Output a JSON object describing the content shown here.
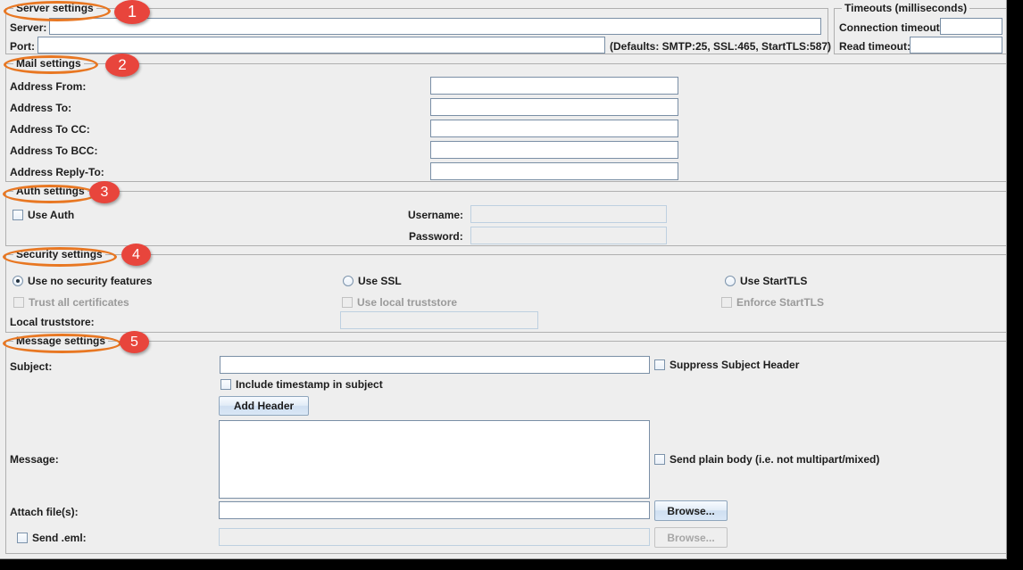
{
  "groups": {
    "server": {
      "legend": "Server settings"
    },
    "timeouts": {
      "legend": "Timeouts (milliseconds)"
    },
    "mail": {
      "legend": "Mail settings"
    },
    "auth": {
      "legend": "Auth settings"
    },
    "security": {
      "legend": "Security settings"
    },
    "message": {
      "legend": "Message settings"
    }
  },
  "server": {
    "server_label": "Server:",
    "server_value": "",
    "port_label": "Port:",
    "port_value": "",
    "port_hint": "(Defaults: SMTP:25, SSL:465, StartTLS:587)"
  },
  "timeouts": {
    "connection_label": "Connection timeout:",
    "connection_value": "",
    "read_label": "Read timeout:",
    "read_value": ""
  },
  "mail": {
    "rows": [
      {
        "label": "Address From:",
        "value": ""
      },
      {
        "label": "Address To:",
        "value": ""
      },
      {
        "label": "Address To CC:",
        "value": ""
      },
      {
        "label": "Address To BCC:",
        "value": ""
      },
      {
        "label": "Address Reply-To:",
        "value": ""
      }
    ]
  },
  "auth": {
    "use_auth_label": "Use Auth",
    "use_auth_checked": false,
    "username_label": "Username:",
    "username_value": "",
    "password_label": "Password:",
    "password_value": ""
  },
  "security": {
    "radio_no_security": "Use no security features",
    "radio_ssl": "Use SSL",
    "radio_starttls": "Use StartTLS",
    "selected_radio": "Use no security features",
    "cb_trust_all": "Trust all certificates",
    "cb_use_local_truststore": "Use local truststore",
    "cb_enforce_starttls": "Enforce StartTLS",
    "local_truststore_label": "Local truststore:",
    "local_truststore_value": ""
  },
  "message": {
    "subject_label": "Subject:",
    "subject_value": "",
    "suppress_subject_header": "Suppress Subject Header",
    "include_timestamp": "Include timestamp in subject",
    "add_header_button": "Add Header",
    "message_label": "Message:",
    "message_value": "",
    "send_plain_body": "Send plain body (i.e. not multipart/mixed)",
    "attach_label": "Attach file(s):",
    "attach_value": "",
    "attach_browse_button": "Browse...",
    "send_eml_label": "Send .eml:",
    "send_eml_value": "",
    "send_eml_browse_button": "Browse..."
  },
  "annotations": {
    "accent_ellipse": "#E87722",
    "accent_badge": "#E8453C",
    "badges": [
      {
        "num": "1"
      },
      {
        "num": "2"
      },
      {
        "num": "3"
      },
      {
        "num": "4"
      },
      {
        "num": "5"
      }
    ]
  }
}
